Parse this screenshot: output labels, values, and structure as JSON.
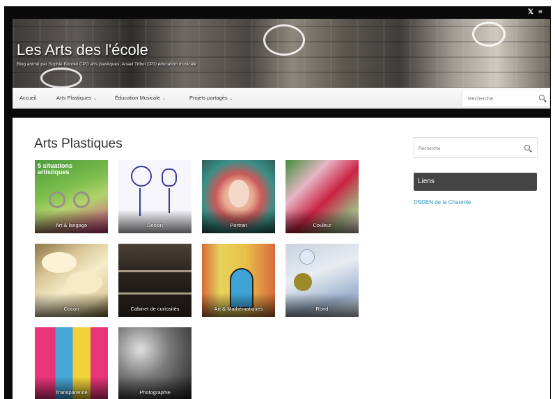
{
  "site": {
    "title": "Les Arts des l'école",
    "description": "Blog animé par Sophie Bonnet CPD arts plastiques, Anael Tribot CPD éducation musicale"
  },
  "social_icons": [
    "twitter-icon",
    "rss-icon"
  ],
  "nav": {
    "items": [
      {
        "label": "Accueil",
        "has_submenu": false
      },
      {
        "label": "Arts Plastiques",
        "has_submenu": true
      },
      {
        "label": "Éducation Musicale",
        "has_submenu": true
      },
      {
        "label": "Projets partagés",
        "has_submenu": true
      }
    ],
    "search_placeholder": "Recherche"
  },
  "page": {
    "title": "Arts Plastiques",
    "tiles": [
      {
        "label": "Art & langage",
        "overlay_text": "5 situations artistiques",
        "colors": [
          "#4a9a3b",
          "#b3d36e",
          "#d83b87"
        ]
      },
      {
        "label": "Dessin",
        "colors": [
          "#ffffff",
          "#eeeef6",
          "#3b3b9c"
        ]
      },
      {
        "label": "Portrait",
        "colors": [
          "#c95a5a",
          "#e8c7b0",
          "#2b7f78"
        ]
      },
      {
        "label": "Couleur",
        "colors": [
          "#cc2244",
          "#3f8f3b",
          "#e6b6c4"
        ]
      },
      {
        "label": "Cocon",
        "colors": [
          "#f6ecc8",
          "#d8c597",
          "#8d7546"
        ]
      },
      {
        "label": "Cabinet de curiosités",
        "colors": [
          "#1d1a16",
          "#4d4136",
          "#a89a86"
        ]
      },
      {
        "label": "Art & Mathématiques",
        "colors": [
          "#e7d25a",
          "#d66a3a",
          "#3fa3d6"
        ]
      },
      {
        "label": "Rond",
        "colors": [
          "#e8ecf2",
          "#9fb5cf",
          "#7b8a3a"
        ]
      },
      {
        "label": "Transparence",
        "colors": [
          "#e8357a",
          "#46a6d8",
          "#f2d23a"
        ]
      },
      {
        "label": "Photographie",
        "colors": [
          "#1a1a1a",
          "#7a7a7a",
          "#e0e0e0"
        ]
      }
    ]
  },
  "sidebar": {
    "search_placeholder": "Recherche",
    "widget_title": "Liens",
    "links": [
      "DSDEN de la Charente"
    ]
  },
  "colors": {
    "link": "#2a8fbd",
    "widget_header": "#444444",
    "frame": "#0a0a0a"
  }
}
